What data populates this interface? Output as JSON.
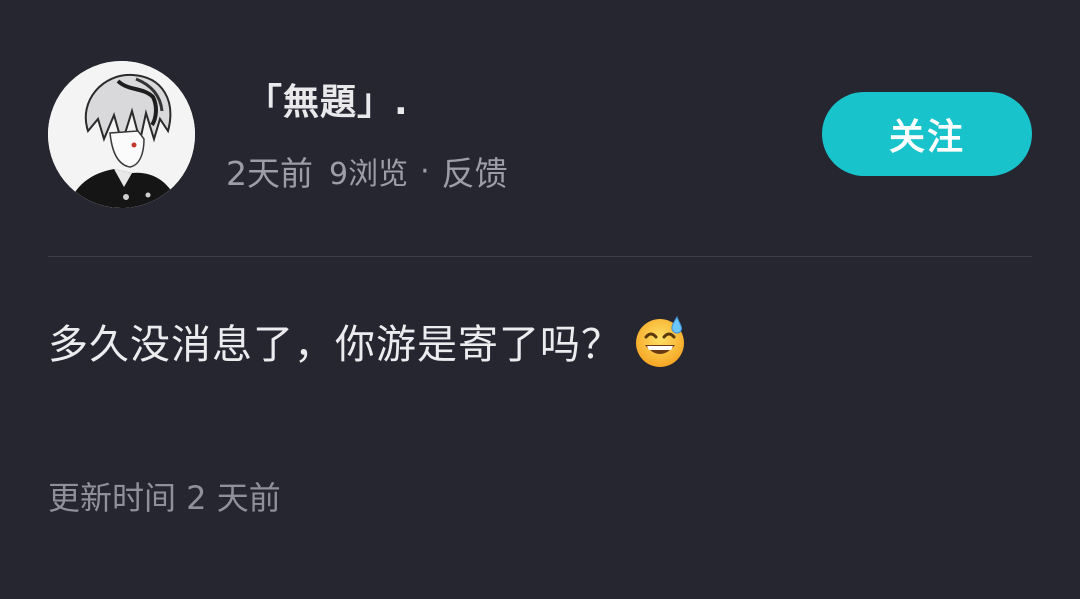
{
  "user": {
    "name": "「無題」.",
    "avatar_icon": "anime-avatar-icon"
  },
  "meta": {
    "time": "2天前",
    "views": "9浏览",
    "separator": "·",
    "feedback": "反馈"
  },
  "follow_button": {
    "label": "关注",
    "color": "#19c3cb"
  },
  "post": {
    "text": "多久没消息了，你游是寄了吗？",
    "emoji_icon": "grinning-sweat-emoji-icon"
  },
  "footer": {
    "updated": "更新时间 2 天前"
  },
  "colors": {
    "background": "#252630",
    "accent": "#19c3cb"
  }
}
